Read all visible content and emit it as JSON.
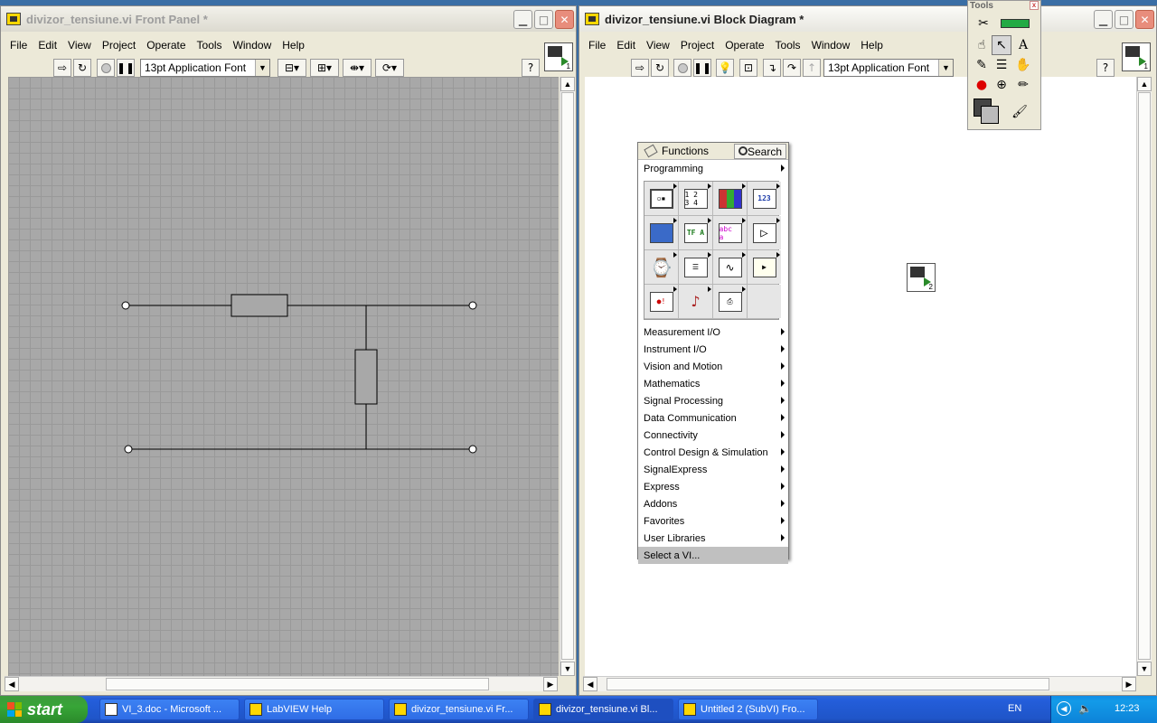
{
  "front_panel": {
    "title": "divizor_tensiune.vi Front Panel *",
    "menus": [
      "File",
      "Edit",
      "View",
      "Project",
      "Operate",
      "Tools",
      "Window",
      "Help"
    ],
    "font_select": "13pt Application Font",
    "icon_num": "1"
  },
  "block_diagram": {
    "title": "divizor_tensiune.vi Block Diagram *",
    "menus": [
      "File",
      "Edit",
      "View",
      "Project",
      "Operate",
      "Tools",
      "Window",
      "Help"
    ],
    "font_select": "13pt Application Font",
    "icon_num": "1",
    "subvi_num": "2"
  },
  "functions_palette": {
    "header": "Functions",
    "search_label": "Search",
    "top_category": "Programming",
    "categories": [
      "Measurement I/O",
      "Instrument I/O",
      "Vision and Motion",
      "Mathematics",
      "Signal Processing",
      "Data Communication",
      "Connectivity",
      "Control Design & Simulation",
      "SignalExpress",
      "Express",
      "Addons",
      "Favorites",
      "User Libraries"
    ],
    "select_vi": "Select a VI...",
    "icon_labels": [
      "",
      "1 2 3 4",
      "",
      "123",
      "",
      "TF A",
      "abc a",
      "",
      "",
      "",
      "",
      "",
      "",
      "",
      "",
      ""
    ]
  },
  "tools_palette": {
    "title": "Tools"
  },
  "taskbar": {
    "start_label": "start",
    "tasks": [
      "VI_3.doc - Microsoft ...",
      "LabVIEW Help",
      "divizor_tensiune.vi Fr...",
      "divizor_tensiune.vi Bl...",
      "Untitled 2 (SubVI) Fro..."
    ],
    "lang": "EN",
    "clock": "12:23"
  },
  "colors": {
    "grid_bg": "#a8a8a8",
    "taskbar": "#245edb",
    "start": "#37a537"
  }
}
